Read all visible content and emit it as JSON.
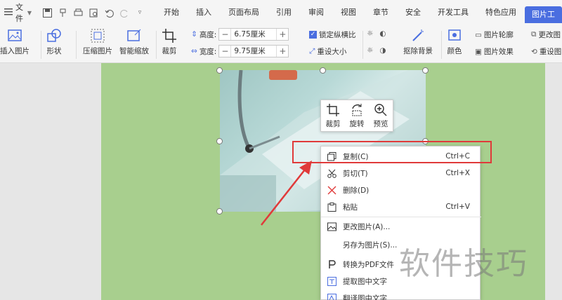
{
  "menubar": {
    "file_label": "文件",
    "tabs": [
      {
        "label": "开始"
      },
      {
        "label": "插入"
      },
      {
        "label": "页面布局"
      },
      {
        "label": "引用"
      },
      {
        "label": "审阅"
      },
      {
        "label": "视图"
      },
      {
        "label": "章节"
      },
      {
        "label": "安全"
      },
      {
        "label": "开发工具"
      },
      {
        "label": "特色应用"
      },
      {
        "label": "图片工"
      }
    ]
  },
  "ribbon": {
    "insert_picture": "插入图片",
    "shape": "形状",
    "compress_picture": "压缩图片",
    "smart_zoom": "智能缩放",
    "crop": "裁剪",
    "height_label": "高度:",
    "height_value": "6.75厘米",
    "width_label": "宽度:",
    "width_value": "9.75厘米",
    "lock_aspect": "锁定纵横比",
    "reset_size": "重设大小",
    "remove_bg": "抠除背景",
    "color": "颜色",
    "picture_outline": "图片轮廓",
    "picture_effect": "图片效果",
    "change_picture": "更改图",
    "reset_picture": "重设图"
  },
  "mini_toolbar": {
    "crop": "裁剪",
    "rotate": "旋转",
    "preview": "预览"
  },
  "context_menu": {
    "items": [
      {
        "label": "复制(C)",
        "shortcut": "Ctrl+C",
        "icon": "copy-icon"
      },
      {
        "label": "剪切(T)",
        "shortcut": "Ctrl+X",
        "icon": "scissors-icon"
      },
      {
        "label": "删除(D)",
        "shortcut": "",
        "icon": "delete-x-icon"
      },
      {
        "label": "粘贴",
        "shortcut": "Ctrl+V",
        "icon": "paste-icon"
      },
      {
        "label": "更改图片(A)...",
        "shortcut": "",
        "icon": "change-picture-icon"
      },
      {
        "label": "另存为图片(S)...",
        "shortcut": "",
        "icon": ""
      },
      {
        "label": "转换为PDF文件",
        "shortcut": "",
        "icon": "pdf-icon"
      },
      {
        "label": "提取图中文字",
        "shortcut": "",
        "icon": "extract-text-icon"
      },
      {
        "label": "翻译图中文字",
        "shortcut": "",
        "icon": "translate-icon"
      }
    ]
  },
  "watermark": "软件技巧",
  "colors": {
    "accent": "#4a6ee0",
    "page_bg": "#a8cf8e",
    "highlight": "#e03a3a"
  }
}
